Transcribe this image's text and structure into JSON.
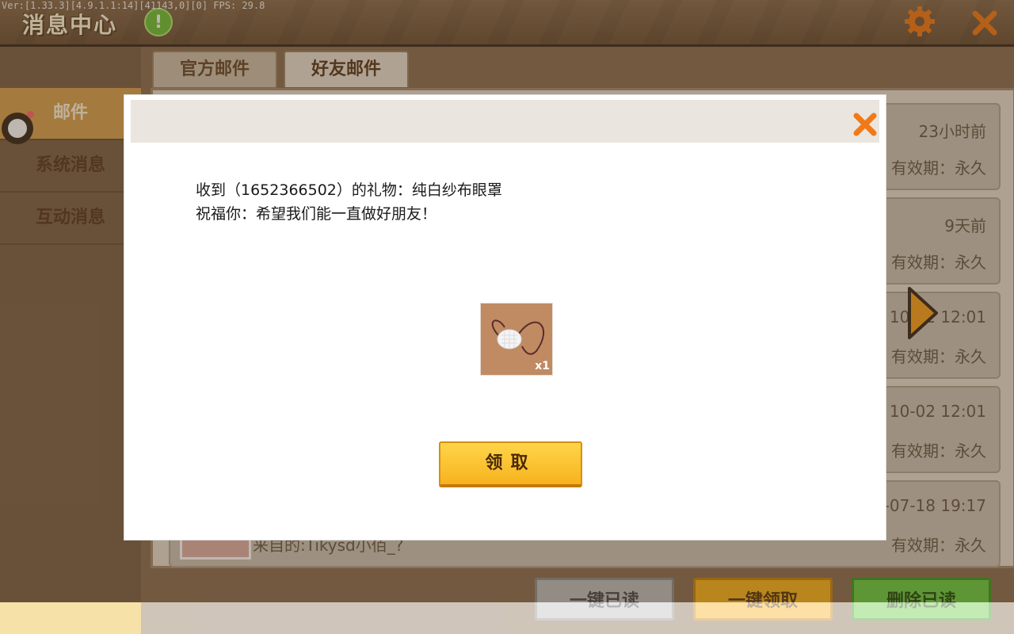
{
  "debug_text": "Ver:[1.33.3][4.9.1.1:14][41143,0][0] FPS: 29.8",
  "header": {
    "title": "消息中心",
    "alert_glyph": "!",
    "settings_icon": "gear-icon",
    "close_icon": "close-icon"
  },
  "sidebar": {
    "items": [
      {
        "label": "邮件",
        "active": true
      },
      {
        "label": "系统消息",
        "active": false
      },
      {
        "label": "互动消息",
        "active": false
      }
    ]
  },
  "tabs": [
    {
      "label": "官方邮件",
      "active": false
    },
    {
      "label": "好友邮件",
      "active": true
    }
  ],
  "mails": [
    {
      "time": "23小时前",
      "validity": "有效期：永久"
    },
    {
      "time": "9天前",
      "validity": "有效期：永久"
    },
    {
      "time": "10-02 12:01",
      "validity": "有效期：永久"
    },
    {
      "time": "10-02 12:01",
      "validity": "有效期：永久"
    },
    {
      "time": "-07-18 19:17",
      "validity": "有效期：永久",
      "sender": "来自的:Tikysd小佰_?"
    }
  ],
  "actions": {
    "mark_all_read": "一键已读",
    "claim_all": "一键领取",
    "delete_read": "删除已读"
  },
  "dialog": {
    "line1": "收到（1652366502）的礼物：纯白纱布眼罩",
    "line2": "祝福你：希望我们能一直做好朋友！",
    "item_qty": "x1",
    "claim_label": "领取",
    "close_icon": "close-icon"
  },
  "colors": {
    "accent_orange": "#f7b21e",
    "green": "#6ccc44",
    "close_orange": "#f07a18"
  }
}
